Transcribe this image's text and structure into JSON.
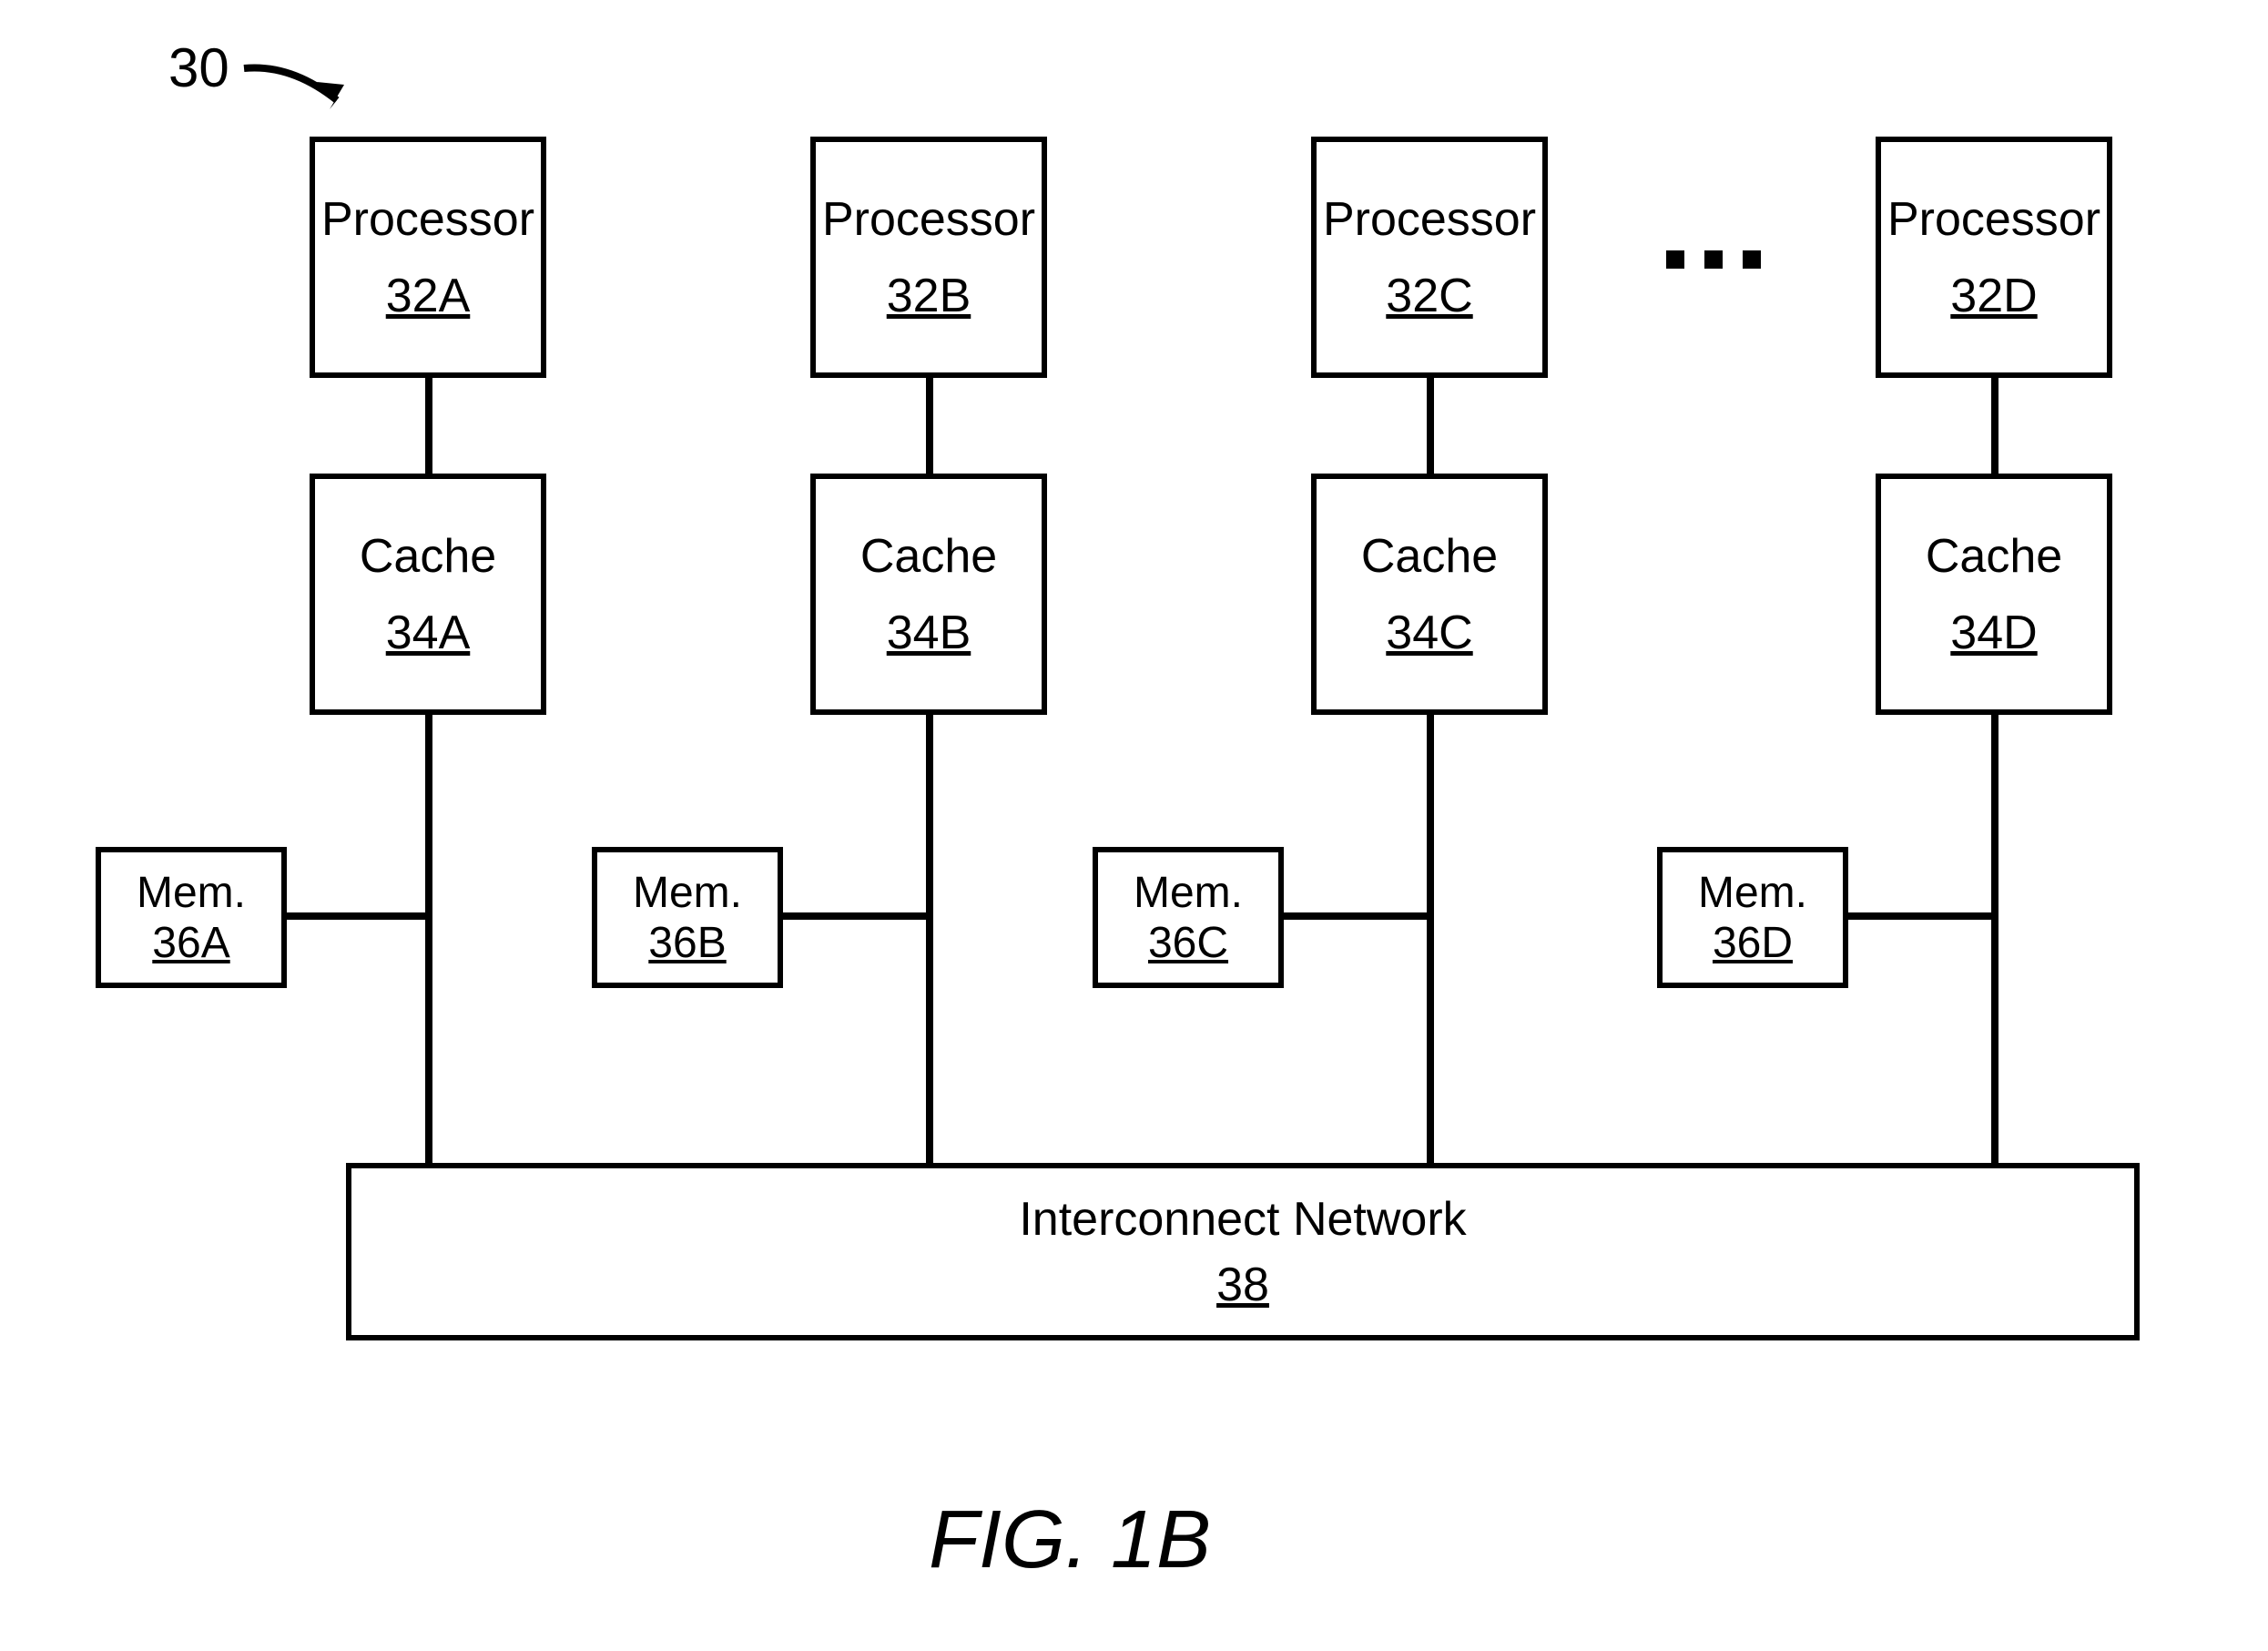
{
  "diagram_ref": "30",
  "figure_label": "FIG. 1B",
  "ellipsis": "...",
  "columns": [
    {
      "processor_label": "Processor",
      "processor_id": "32A",
      "cache_label": "Cache",
      "cache_id": "34A",
      "mem_label": "Mem.",
      "mem_id": "36A"
    },
    {
      "processor_label": "Processor",
      "processor_id": "32B",
      "cache_label": "Cache",
      "cache_id": "34B",
      "mem_label": "Mem.",
      "mem_id": "36B"
    },
    {
      "processor_label": "Processor",
      "processor_id": "32C",
      "cache_label": "Cache",
      "cache_id": "34C",
      "mem_label": "Mem.",
      "mem_id": "36C"
    },
    {
      "processor_label": "Processor",
      "processor_id": "32D",
      "cache_label": "Cache",
      "cache_id": "34D",
      "mem_label": "Mem.",
      "mem_id": "36D"
    }
  ],
  "interconnect": {
    "label": "Interconnect Network",
    "id": "38"
  }
}
